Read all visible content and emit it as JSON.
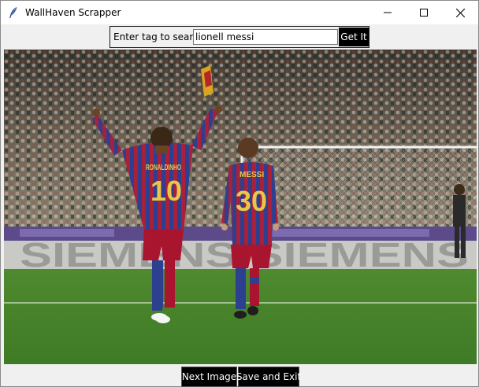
{
  "window": {
    "title": "WallHaven Scrapper",
    "icon": "feather-icon",
    "controls": [
      "minimize-icon",
      "maximize-icon",
      "close-icon"
    ]
  },
  "search": {
    "label": "Enter tag to search",
    "value": "lionell messi",
    "button_label": "Get It"
  },
  "image": {
    "banner_text": "SIEMENS SIEMENS",
    "player_left": {
      "name": "RONALDINHO",
      "number": "10"
    },
    "player_right": {
      "name": "MESSI",
      "number": "30"
    }
  },
  "actions": {
    "next_label": "Next Image",
    "save_exit_label": "Save and Exit"
  }
}
